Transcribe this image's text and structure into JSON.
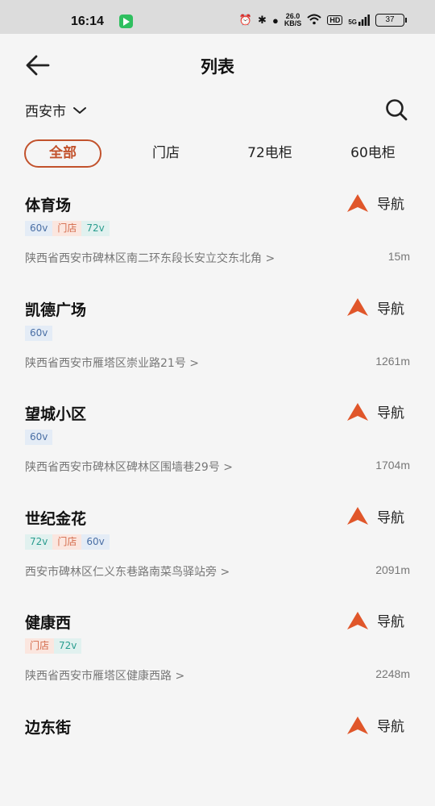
{
  "status": {
    "time": "16:14",
    "net_speed_value": "26.0",
    "net_speed_unit": "KB/S",
    "hd": "HD",
    "signal": "5G",
    "battery": "37"
  },
  "header": {
    "title": "列表"
  },
  "location": {
    "city": "西安市"
  },
  "tabs": [
    {
      "label": "全部",
      "active": true
    },
    {
      "label": "门店",
      "active": false
    },
    {
      "label": "72电柜",
      "active": false
    },
    {
      "label": "60电柜",
      "active": false
    }
  ],
  "colors": {
    "accent": "#c2522c",
    "nav_icon": "#e0562a",
    "background": "#f5f5f5"
  },
  "nav_label": "导航",
  "items": [
    {
      "name": "体育场",
      "tags": [
        "60v",
        "门店",
        "72v"
      ],
      "address": "陕西省西安市碑林区南二环东段长安立交东北角 >",
      "distance": "15m"
    },
    {
      "name": "凯德广场",
      "tags": [
        "60v"
      ],
      "address": "陕西省西安市雁塔区崇业路21号 >",
      "distance": "1261m"
    },
    {
      "name": "望城小区",
      "tags": [
        "60v"
      ],
      "address": "陕西省西安市碑林区碑林区围墙巷29号 >",
      "distance": "1704m"
    },
    {
      "name": "世纪金花",
      "tags": [
        "72v",
        "门店",
        "60v"
      ],
      "address": "西安市碑林区仁义东巷路南菜鸟驿站旁 >",
      "distance": "2091m"
    },
    {
      "name": "健康西",
      "tags": [
        "门店",
        "72v"
      ],
      "address": "陕西省西安市雁塔区健康西路 >",
      "distance": "2248m"
    },
    {
      "name": "边东街",
      "tags": [],
      "address": "",
      "distance": ""
    }
  ]
}
